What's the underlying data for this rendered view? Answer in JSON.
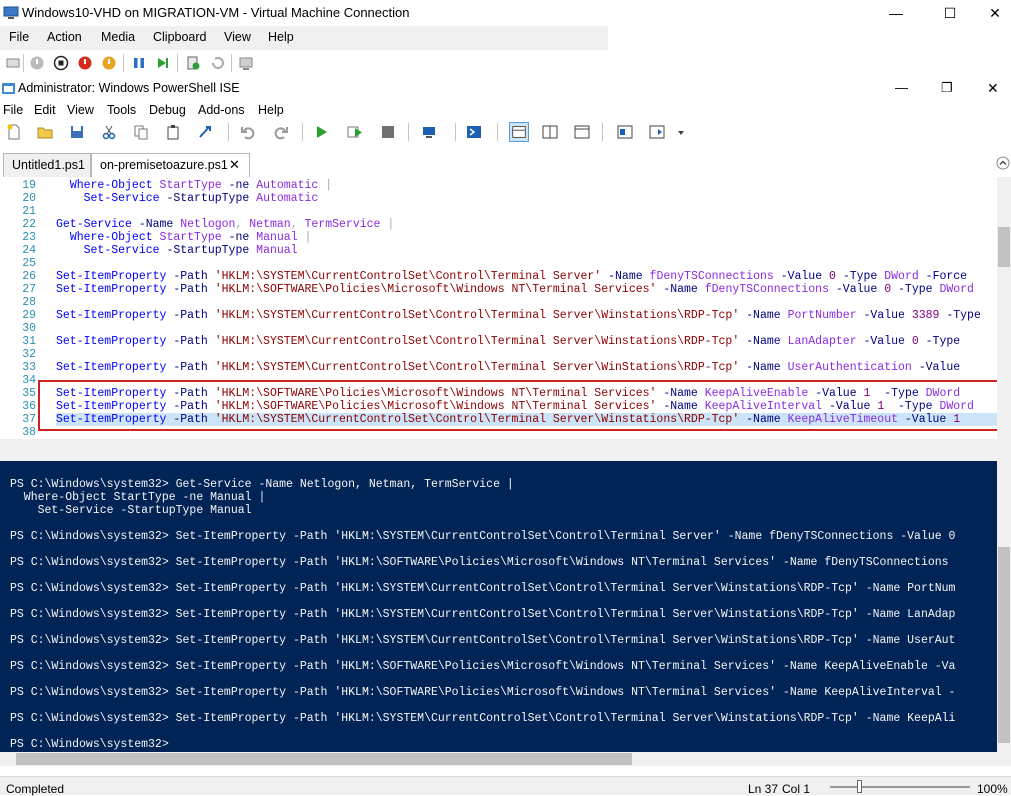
{
  "vm_window": {
    "title": "Windows10-VHD on MIGRATION-VM - Virtual Machine Connection",
    "menu": [
      "File",
      "Action",
      "Media",
      "Clipboard",
      "View",
      "Help"
    ],
    "minimize_glyph": "—",
    "maximize_glyph": "☐",
    "close_glyph": "✕"
  },
  "ise_window": {
    "title": "Administrator: Windows PowerShell ISE",
    "menu": [
      "File",
      "Edit",
      "View",
      "Tools",
      "Debug",
      "Add-ons",
      "Help"
    ],
    "minimize_glyph": "—",
    "restore_glyph": "❐",
    "close_glyph": "✕"
  },
  "tabs": [
    {
      "label": "Untitled1.ps1",
      "active": false
    },
    {
      "label": "on-premisetoazure.ps1",
      "active": true,
      "close": "✕"
    }
  ],
  "editor_lines": [
    {
      "n": "19",
      "text": "  Where-Object StartType -ne Automatic |"
    },
    {
      "n": "20",
      "text": "    Set-Service -StartupType Automatic"
    },
    {
      "n": "21",
      "text": ""
    },
    {
      "n": "22",
      "text": "Get-Service -Name Netlogon, Netman, TermService |"
    },
    {
      "n": "23",
      "text": "  Where-Object StartType -ne Manual |"
    },
    {
      "n": "24",
      "text": "    Set-Service -StartupType Manual"
    },
    {
      "n": "25",
      "text": ""
    },
    {
      "n": "26",
      "text": "Set-ItemProperty -Path 'HKLM:\\SYSTEM\\CurrentControlSet\\Control\\Terminal Server' -Name fDenyTSConnections -Value 0 -Type DWord -Force"
    },
    {
      "n": "27",
      "text": "Set-ItemProperty -Path 'HKLM:\\SOFTWARE\\Policies\\Microsoft\\Windows NT\\Terminal Services' -Name fDenyTSConnections -Value 0 -Type DWord"
    },
    {
      "n": "28",
      "text": ""
    },
    {
      "n": "29",
      "text": "Set-ItemProperty -Path 'HKLM:\\SYSTEM\\CurrentControlSet\\Control\\Terminal Server\\Winstations\\RDP-Tcp' -Name PortNumber -Value 3389 -Type"
    },
    {
      "n": "30",
      "text": ""
    },
    {
      "n": "31",
      "text": "Set-ItemProperty -Path 'HKLM:\\SYSTEM\\CurrentControlSet\\Control\\Terminal Server\\Winstations\\RDP-Tcp' -Name LanAdapter -Value 0 -Type"
    },
    {
      "n": "32",
      "text": ""
    },
    {
      "n": "33",
      "text": "Set-ItemProperty -Path 'HKLM:\\SYSTEM\\CurrentControlSet\\Control\\Terminal Server\\WinStations\\RDP-Tcp' -Name UserAuthentication -Value"
    },
    {
      "n": "34",
      "text": ""
    },
    {
      "n": "35",
      "text": "Set-ItemProperty -Path 'HKLM:\\SOFTWARE\\Policies\\Microsoft\\Windows NT\\Terminal Services' -Name KeepAliveEnable -Value 1  -Type DWord"
    },
    {
      "n": "36",
      "text": "Set-ItemProperty -Path 'HKLM:\\SOFTWARE\\Policies\\Microsoft\\Windows NT\\Terminal Services' -Name KeepAliveInterval -Value 1  -Type DWord"
    },
    {
      "n": "37",
      "text": "Set-ItemProperty -Path 'HKLM:\\SYSTEM\\CurrentControlSet\\Control\\Terminal Server\\Winstations\\RDP-Tcp' -Name KeepAliveTimeout -Value 1"
    },
    {
      "n": "38",
      "text": ""
    }
  ],
  "console_lines": [
    "PS C:\\Windows\\system32> Get-Service -Name Netlogon, Netman, TermService |",
    "  Where-Object StartType -ne Manual |",
    "    Set-Service -StartupType Manual",
    "",
    "PS C:\\Windows\\system32> Set-ItemProperty -Path 'HKLM:\\SYSTEM\\CurrentControlSet\\Control\\Terminal Server' -Name fDenyTSConnections -Value 0",
    "",
    "PS C:\\Windows\\system32> Set-ItemProperty -Path 'HKLM:\\SOFTWARE\\Policies\\Microsoft\\Windows NT\\Terminal Services' -Name fDenyTSConnections",
    "",
    "PS C:\\Windows\\system32> Set-ItemProperty -Path 'HKLM:\\SYSTEM\\CurrentControlSet\\Control\\Terminal Server\\Winstations\\RDP-Tcp' -Name PortNum",
    "",
    "PS C:\\Windows\\system32> Set-ItemProperty -Path 'HKLM:\\SYSTEM\\CurrentControlSet\\Control\\Terminal Server\\Winstations\\RDP-Tcp' -Name LanAdap",
    "",
    "PS C:\\Windows\\system32> Set-ItemProperty -Path 'HKLM:\\SYSTEM\\CurrentControlSet\\Control\\Terminal Server\\WinStations\\RDP-Tcp' -Name UserAut",
    "",
    "PS C:\\Windows\\system32> Set-ItemProperty -Path 'HKLM:\\SOFTWARE\\Policies\\Microsoft\\Windows NT\\Terminal Services' -Name KeepAliveEnable -Va",
    "",
    "PS C:\\Windows\\system32> Set-ItemProperty -Path 'HKLM:\\SOFTWARE\\Policies\\Microsoft\\Windows NT\\Terminal Services' -Name KeepAliveInterval -",
    "",
    "PS C:\\Windows\\system32> Set-ItemProperty -Path 'HKLM:\\SYSTEM\\CurrentControlSet\\Control\\Terminal Server\\Winstations\\RDP-Tcp' -Name KeepAli",
    "",
    "PS C:\\Windows\\system32>"
  ],
  "status": {
    "text": "Completed",
    "line": "Ln 37",
    "col": "Col 1",
    "zoom": "100%"
  },
  "colors": {
    "console_bg": "#012456",
    "selection": "#cce4f7",
    "highlight_box": "#d02020"
  }
}
